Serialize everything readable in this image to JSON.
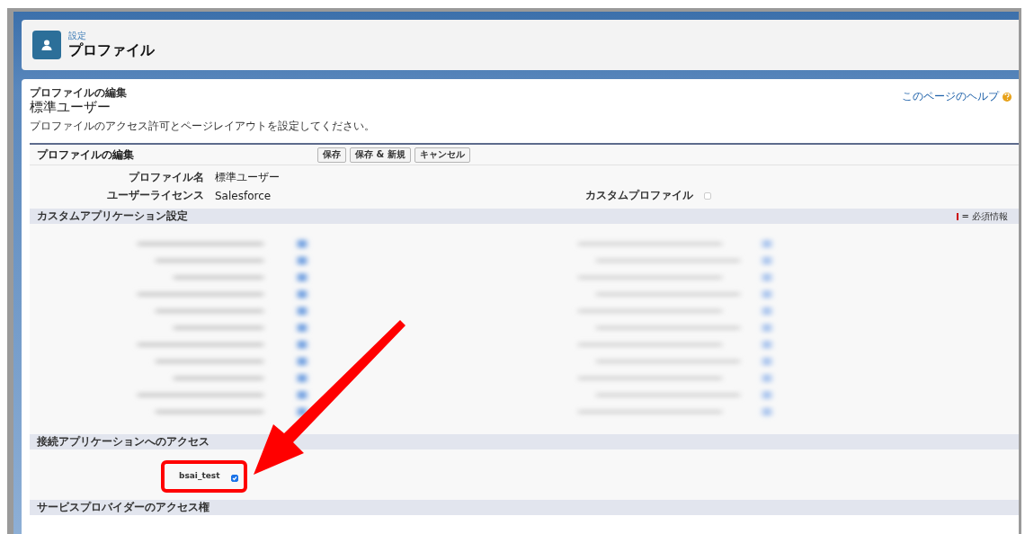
{
  "header": {
    "breadcrumb": "設定",
    "title": "プロファイル"
  },
  "page": {
    "subtitle": "プロファイルの編集",
    "title": "標準ユーザー",
    "help_link": "このページのヘルプ",
    "description": "プロファイルのアクセス許可とページレイアウトを設定してください。"
  },
  "edit_block": {
    "title": "プロファイルの編集",
    "buttons": [
      "保存",
      "保存 & 新規",
      "キャンセル"
    ]
  },
  "fields": [
    {
      "label": "プロファイル名",
      "value": "標準ユーザー"
    },
    {
      "label": "ユーザーライセンス",
      "value": "Salesforce"
    }
  ],
  "custom_profile": {
    "label": "カスタムプロファイル",
    "checked": false
  },
  "custom_apps": {
    "title": "カスタムアプリケーション設定",
    "required_legend": "= 必須情報"
  },
  "connected_apps": {
    "title": "接続アプリケーションへのアクセス",
    "apps": [
      {
        "name": "bsai_test",
        "checked": true
      }
    ]
  },
  "service_providers": {
    "title": "サービスプロバイダーのアクセス権"
  }
}
